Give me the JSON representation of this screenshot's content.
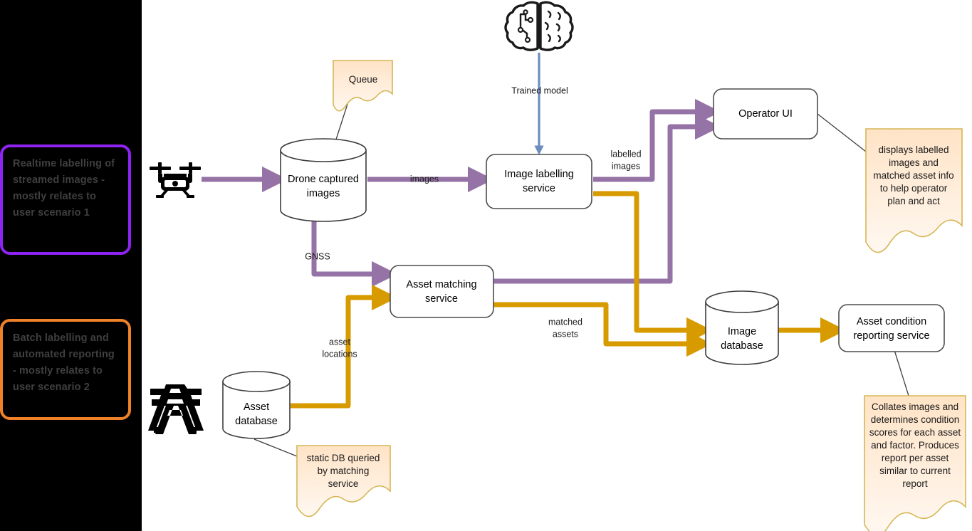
{
  "diagram": {
    "title": "Drone image labelling and asset condition reporting architecture",
    "background": "#ffffff",
    "left_panel_color": "#000000",
    "colors": {
      "purple_flow": "#9673a6",
      "orange_flow": "#d79b00",
      "blue_flow": "#6c8ebf",
      "note_fill_top": "#ffe6cc",
      "note_fill_bottom": "#fff6ec",
      "note_stroke": "#d6b656",
      "legend_purple_border": "#8f24f2",
      "legend_orange_border": "#ef8129",
      "node_stroke": "#4d4d4d",
      "node_fill": "#ffffff"
    }
  },
  "legend": {
    "items": [
      {
        "id": "legend-realtime",
        "text": "Realtime labelling of streamed images - mostly relates to user scenario 1",
        "border_color": "#8f24f2",
        "accent": "purple"
      },
      {
        "id": "legend-batch",
        "text": "Batch labelling and automated reporting - mostly relates to user scenario 2",
        "border_color": "#ef8129",
        "accent": "orange"
      }
    ]
  },
  "icons": [
    {
      "id": "drone-icon",
      "name": "drone-icon",
      "label": ""
    },
    {
      "id": "pylon-icon",
      "name": "transmission-tower-icon",
      "label": ""
    },
    {
      "id": "brain-icon",
      "name": "ai-brain-icon",
      "label": ""
    }
  ],
  "nodes": [
    {
      "id": "drone-captured-images",
      "type": "cylinder",
      "label": "Drone captured\nimages",
      "lines": [
        "Drone captured",
        "images"
      ]
    },
    {
      "id": "image-labelling-service",
      "type": "rounded-rect",
      "label": "Image labelling\nservice",
      "lines": [
        "Image labelling",
        "service"
      ]
    },
    {
      "id": "operator-ui",
      "type": "rounded-rect",
      "label": "Operator UI",
      "lines": [
        "Operator UI"
      ]
    },
    {
      "id": "asset-matching-service",
      "type": "rounded-rect",
      "label": "Asset matching\nservice",
      "lines": [
        "Asset matching",
        "service"
      ]
    },
    {
      "id": "asset-database",
      "type": "cylinder",
      "label": "Asset\ndatabase",
      "lines": [
        "Asset",
        "database"
      ]
    },
    {
      "id": "image-database",
      "type": "cylinder",
      "label": "Image\ndatabase",
      "lines": [
        "Image",
        "database"
      ]
    },
    {
      "id": "asset-condition-reporting-service",
      "type": "rounded-rect",
      "label": "Asset condition\nreporting service",
      "lines": [
        "Asset condition",
        "reporting service"
      ]
    }
  ],
  "edge_labels": [
    {
      "id": "label-trained-model",
      "text": "Trained model"
    },
    {
      "id": "label-images",
      "text": "images"
    },
    {
      "id": "label-gnss",
      "text": "GNSS"
    },
    {
      "id": "label-labelled-images",
      "lines": [
        "labelled",
        "images"
      ]
    },
    {
      "id": "label-asset-locations",
      "lines": [
        "asset",
        "locations"
      ]
    },
    {
      "id": "label-matched-assets",
      "lines": [
        "matched",
        "assets"
      ]
    }
  ],
  "notes": [
    {
      "id": "note-queue",
      "lines": [
        "Queue"
      ],
      "attached_to": "drone-captured-images"
    },
    {
      "id": "note-operator-ui",
      "lines": [
        "displays labelled",
        "images and",
        "matched asset info",
        "to help operator",
        "plan and act"
      ],
      "attached_to": "operator-ui"
    },
    {
      "id": "note-static-db",
      "lines": [
        "static DB queried",
        "by matching",
        "service"
      ],
      "attached_to": "asset-database"
    },
    {
      "id": "note-reporting",
      "lines": [
        "Collates images and",
        "determines condition",
        "scores for each asset",
        "and factor. Produces",
        "report per asset",
        "similar to current",
        "report"
      ],
      "attached_to": "asset-condition-reporting-service"
    }
  ]
}
